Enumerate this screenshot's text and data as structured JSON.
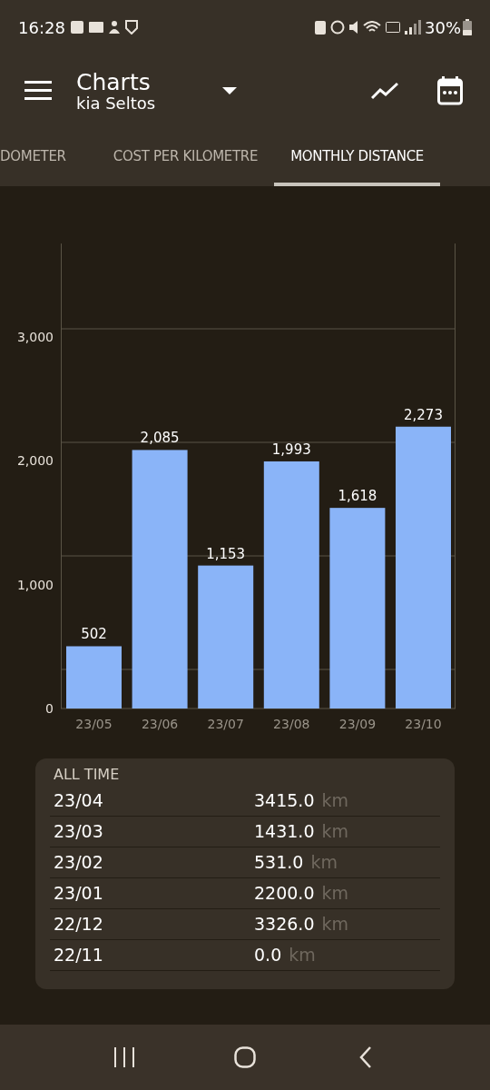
{
  "status_bar": {
    "time": "16:28",
    "battery": "30%"
  },
  "app_bar": {
    "title": "Charts",
    "subtitle": "kia Seltos"
  },
  "tabs": [
    {
      "label": "DOMETER",
      "selected": false
    },
    {
      "label": "COST PER KILOMETRE",
      "selected": false
    },
    {
      "label": "MONTHLY DISTANCE",
      "selected": true
    }
  ],
  "chart_data": {
    "type": "bar",
    "categories": [
      "23/05",
      "23/06",
      "23/07",
      "23/08",
      "23/09",
      "23/10"
    ],
    "values": [
      502,
      2085,
      1153,
      1993,
      1618,
      2273
    ],
    "ylim": [
      0,
      3750
    ],
    "yticks": [
      {
        "value": 0,
        "label": "0"
      },
      {
        "value": 1000,
        "label": "1,000"
      },
      {
        "value": 2000,
        "label": "2,000"
      },
      {
        "value": 3000,
        "label": "3,000"
      }
    ],
    "value_labels": [
      "502",
      "2,085",
      "1,153",
      "1,993",
      "1,618",
      "2,273"
    ]
  },
  "summary": {
    "title": "ALL TIME",
    "rows": [
      {
        "month": "23/04",
        "value": "3415.0",
        "unit": "km"
      },
      {
        "month": "23/03",
        "value": "1431.0",
        "unit": "km"
      },
      {
        "month": "23/02",
        "value": "531.0",
        "unit": "km"
      },
      {
        "month": "23/01",
        "value": "2200.0",
        "unit": "km"
      },
      {
        "month": "22/12",
        "value": "3326.0",
        "unit": "km"
      },
      {
        "month": "22/11",
        "value": "0.0",
        "unit": "km"
      }
    ]
  }
}
